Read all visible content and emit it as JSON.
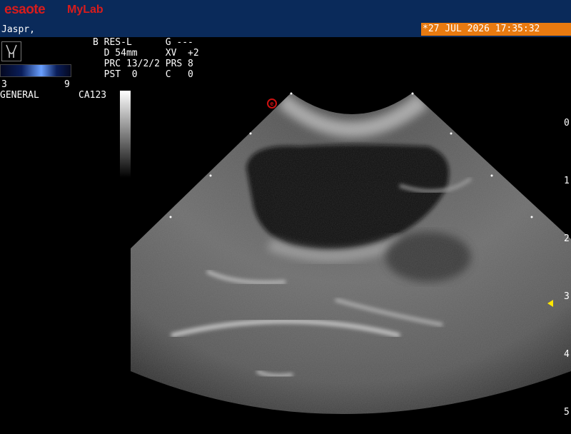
{
  "header": {
    "brand": "esaote",
    "product": "MyLab"
  },
  "patient": {
    "name": "Jaspr,"
  },
  "datetime": "*27 JUL 2026 17:35:32",
  "params": {
    "r0": "B RES-L      G ---",
    "r1": "  D 54mm     XV  +2",
    "r2": "  PRC 13/2/2 PRS 8",
    "r3": "  PST  0     C   0"
  },
  "colormap": {
    "min": "3",
    "max": "9"
  },
  "preset": "GENERAL",
  "probe": "CA123",
  "depth_scale": {
    "labels": [
      "0",
      "1",
      "2",
      "3",
      "4",
      "5"
    ]
  },
  "icons": {
    "body": "body-mark-icon",
    "orientation": "probe-orientation-icon",
    "focus": "focus-marker-icon"
  },
  "orientation_label": "e",
  "colors": {
    "header_bg": "#0a2a5a",
    "brand": "#d81c1c",
    "datetime_bg": "#e87a10",
    "focus": "#ffe600"
  }
}
